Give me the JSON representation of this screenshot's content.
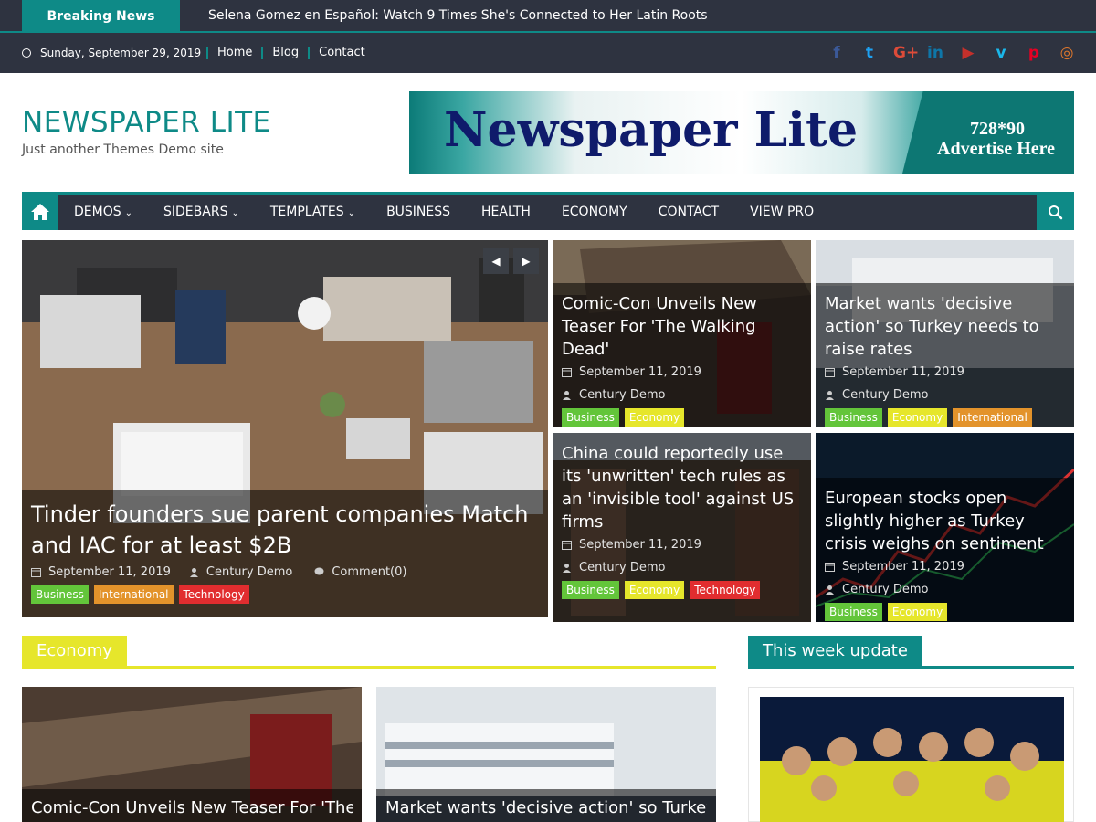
{
  "breaking": {
    "label": "Breaking News",
    "headline": "Selena Gomez en Español: Watch 9 Times She's Connected to Her Latin Roots"
  },
  "topbar": {
    "date": "Sunday, September 29, 2019",
    "links": [
      "Home",
      "Blog",
      "Contact"
    ],
    "socials": [
      {
        "icon": "facebook-icon",
        "glyph": "f",
        "color": "#3b5998"
      },
      {
        "icon": "twitter-icon",
        "glyph": "t",
        "color": "#1da1f2"
      },
      {
        "icon": "google-plus-icon",
        "glyph": "G+",
        "color": "#dd4b39"
      },
      {
        "icon": "linkedin-icon",
        "glyph": "in",
        "color": "#0e76a8"
      },
      {
        "icon": "youtube-icon",
        "glyph": "▶",
        "color": "#c4302b"
      },
      {
        "icon": "vimeo-icon",
        "glyph": "v",
        "color": "#1ab7ea"
      },
      {
        "icon": "pinterest-icon",
        "glyph": "p",
        "color": "#e60023"
      },
      {
        "icon": "instagram-icon",
        "glyph": "◎",
        "color": "#e1782c"
      }
    ]
  },
  "header": {
    "site_title": "NEWSPAPER LITE",
    "tagline": "Just another Themes Demo site",
    "banner_title": "Newspaper Lite",
    "banner_size": "728*90",
    "banner_cta": "Advertise Here"
  },
  "nav": {
    "items": [
      {
        "label": "DEMOS",
        "dropdown": true
      },
      {
        "label": "SIDEBARS",
        "dropdown": true
      },
      {
        "label": "TEMPLATES",
        "dropdown": true
      },
      {
        "label": "BUSINESS",
        "dropdown": false
      },
      {
        "label": "HEALTH",
        "dropdown": false
      },
      {
        "label": "ECONOMY",
        "dropdown": false
      },
      {
        "label": "CONTACT",
        "dropdown": false
      },
      {
        "label": "VIEW PRO",
        "dropdown": false
      }
    ]
  },
  "featured": {
    "main": {
      "title": "Tinder founders sue parent companies Match and IAC for at least $2B",
      "date": "September 11, 2019",
      "author": "Century Demo",
      "comments": "Comment(0)",
      "tags": [
        "Business",
        "International",
        "Technology"
      ]
    },
    "cards": [
      {
        "title": "Comic-Con Unveils New Teaser For 'The Walking Dead'",
        "date": "September 11, 2019",
        "author": "Century Demo",
        "tags": [
          "Business",
          "Economy"
        ]
      },
      {
        "title": "Market wants 'decisive action' so Turkey needs to raise rates",
        "date": "September 11, 2019",
        "author": "Century Demo",
        "tags": [
          "Business",
          "Economy",
          "International"
        ]
      },
      {
        "title": "China could reportedly use its 'unwritten' tech rules as an 'invisible tool' against US firms",
        "date": "September 11, 2019",
        "author": "Century Demo",
        "tags": [
          "Business",
          "Economy",
          "Technology"
        ]
      },
      {
        "title": "European stocks open slightly higher as Turkey crisis weighs on sentiment",
        "date": "September 11, 2019",
        "author": "Century Demo",
        "tags": [
          "Business",
          "Economy"
        ]
      }
    ]
  },
  "economy_section": {
    "label": "Economy",
    "cards": [
      {
        "title": "Comic-Con Unveils New Teaser For 'The Walking Dead'"
      },
      {
        "title": "Market wants 'decisive action' so Turkey needs to raise rates"
      }
    ]
  },
  "sidebar_widget": {
    "label": "This week update"
  },
  "colors": {
    "accent": "#0e8a87",
    "dark": "#2e3340",
    "economy": "#e6e62b"
  }
}
